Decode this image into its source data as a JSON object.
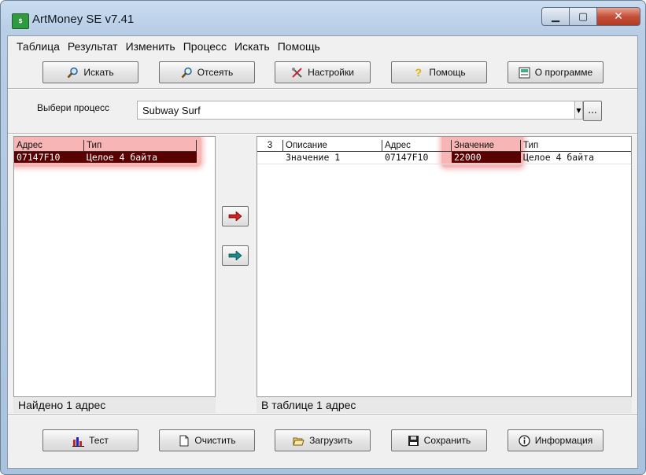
{
  "window": {
    "title": "ArtMoney SE v7.41",
    "app_icon": "artmoney-app-icon"
  },
  "window_buttons": {
    "minimize": "minimize-icon",
    "maximize": "maximize-icon",
    "close": "close-icon"
  },
  "menu": [
    "Таблица",
    "Результат",
    "Изменить",
    "Процесс",
    "Искать",
    "Помощь"
  ],
  "toolbar": {
    "search": "Искать",
    "filter": "Отсеять",
    "settings": "Настройки",
    "help": "Помощь",
    "about": "О программе"
  },
  "process": {
    "label": "Выбери процесс",
    "value": "Subway Surf",
    "browse": "..."
  },
  "left_table": {
    "columns": [
      "Адрес",
      "Тип"
    ],
    "rows": [
      {
        "address": "07147F10",
        "type": "Целое 4 байта"
      }
    ],
    "status": "Найдено 1 адрес"
  },
  "right_table": {
    "columns": [
      "3",
      "Описание",
      "Адрес",
      "Значение",
      "Тип"
    ],
    "rows": [
      {
        "description": "Значение 1",
        "address": "07147F10",
        "value": "22000",
        "type": "Целое 4 байта"
      }
    ],
    "status": "В таблице 1 адрес"
  },
  "bottom": {
    "test": "Тест",
    "clear": "Очистить",
    "load": "Загрузить",
    "save": "Сохранить",
    "info": "Информация"
  },
  "colors": {
    "selected_row": "#5a0000",
    "highlight": "#eb4646",
    "arrow_red": "#d42020",
    "arrow_teal": "#1a8a8a"
  }
}
